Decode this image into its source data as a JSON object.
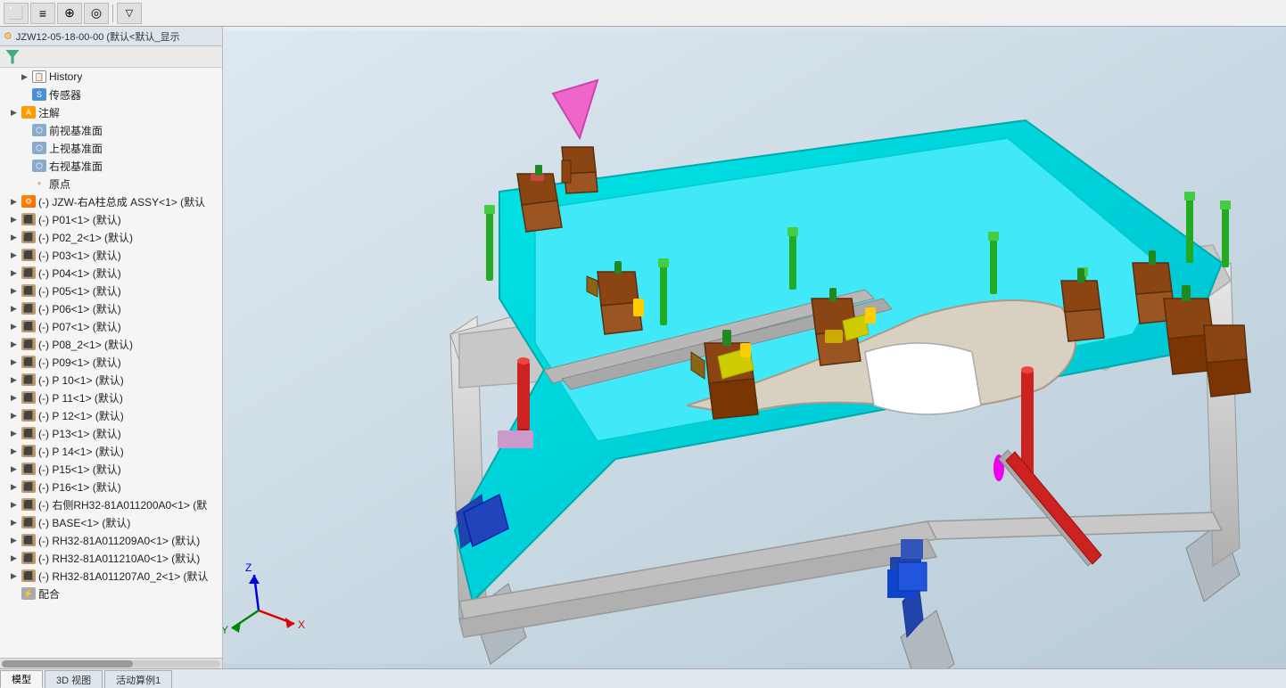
{
  "toolbar": {
    "buttons": [
      "⬜",
      "≡",
      "⊕",
      "◎",
      "⊗"
    ]
  },
  "sidebar": {
    "header_title": "JZW12-05-18-00-00  (默认<默认_显示",
    "tree_items": [
      {
        "id": "history",
        "label": "History",
        "icon": "history",
        "indent": 2,
        "expandable": true
      },
      {
        "id": "sensor",
        "label": "传感器",
        "icon": "sensor",
        "indent": 2,
        "expandable": false
      },
      {
        "id": "annotation",
        "label": "注解",
        "icon": "annotation",
        "indent": 1,
        "expandable": true
      },
      {
        "id": "front-plane",
        "label": "前视基准面",
        "icon": "plane",
        "indent": 2,
        "expandable": false
      },
      {
        "id": "top-plane",
        "label": "上视基准面",
        "icon": "plane",
        "indent": 2,
        "expandable": false
      },
      {
        "id": "right-plane",
        "label": "右视基准面",
        "icon": "plane",
        "indent": 2,
        "expandable": false
      },
      {
        "id": "origin",
        "label": "原点",
        "icon": "origin",
        "indent": 2,
        "expandable": false
      },
      {
        "id": "p1",
        "label": "(-) JZW-右A柱总成 ASSY<1> (默认",
        "icon": "assembly",
        "indent": 1,
        "expandable": true
      },
      {
        "id": "p2",
        "label": "(-) P01<1> (默认)",
        "icon": "part",
        "indent": 1,
        "expandable": true
      },
      {
        "id": "p3",
        "label": "(-) P02_2<1> (默认)",
        "icon": "part",
        "indent": 1,
        "expandable": true
      },
      {
        "id": "p4",
        "label": "(-) P03<1> (默认)",
        "icon": "part",
        "indent": 1,
        "expandable": true
      },
      {
        "id": "p5",
        "label": "(-) P04<1> (默认)",
        "icon": "part",
        "indent": 1,
        "expandable": true
      },
      {
        "id": "p6",
        "label": "(-) P05<1> (默认)",
        "icon": "part",
        "indent": 1,
        "expandable": true
      },
      {
        "id": "p7",
        "label": "(-) P06<1> (默认)",
        "icon": "part",
        "indent": 1,
        "expandable": true
      },
      {
        "id": "p8",
        "label": "(-) P07<1> (默认)",
        "icon": "part",
        "indent": 1,
        "expandable": true
      },
      {
        "id": "p9",
        "label": "(-) P08_2<1> (默认)",
        "icon": "part",
        "indent": 1,
        "expandable": true
      },
      {
        "id": "p10",
        "label": "(-) P09<1> (默认)",
        "icon": "part",
        "indent": 1,
        "expandable": true
      },
      {
        "id": "p11",
        "label": "(-) P 10<1> (默认)",
        "icon": "part",
        "indent": 1,
        "expandable": true
      },
      {
        "id": "p12",
        "label": "(-) P 11<1> (默认)",
        "icon": "part",
        "indent": 1,
        "expandable": true
      },
      {
        "id": "p13",
        "label": "(-) P 12<1> (默认)",
        "icon": "part",
        "indent": 1,
        "expandable": true
      },
      {
        "id": "p14",
        "label": "(-) P13<1> (默认)",
        "icon": "part",
        "indent": 1,
        "expandable": true
      },
      {
        "id": "p15",
        "label": "(-) P 14<1> (默认)",
        "icon": "part",
        "indent": 1,
        "expandable": true
      },
      {
        "id": "p16",
        "label": "(-) P15<1> (默认)",
        "icon": "part",
        "indent": 1,
        "expandable": true
      },
      {
        "id": "p17",
        "label": "(-) P16<1> (默认)",
        "icon": "part",
        "indent": 1,
        "expandable": true
      },
      {
        "id": "p18",
        "label": "(-) 右侧RH32-81A011200A0<1> (默",
        "icon": "part",
        "indent": 1,
        "expandable": true
      },
      {
        "id": "p19",
        "label": "(-) BASE<1> (默认)",
        "icon": "part",
        "indent": 1,
        "expandable": true
      },
      {
        "id": "p20",
        "label": "(-) RH32-81A011209A0<1> (默认)",
        "icon": "part",
        "indent": 1,
        "expandable": true
      },
      {
        "id": "p21",
        "label": "(-) RH32-81A011210A0<1> (默认)",
        "icon": "part",
        "indent": 1,
        "expandable": true
      },
      {
        "id": "p22",
        "label": "(-) RH32-81A011207A0_2<1> (默认",
        "icon": "part",
        "indent": 1,
        "expandable": true
      },
      {
        "id": "mating",
        "label": "配合",
        "icon": "mating",
        "indent": 1,
        "expandable": false
      }
    ]
  },
  "bottom_tabs": [
    {
      "id": "model",
      "label": "模型",
      "active": true
    },
    {
      "id": "3dview",
      "label": "3D 视图",
      "active": false
    },
    {
      "id": "motion",
      "label": "活动算例1",
      "active": false
    }
  ],
  "viewport": {
    "background_color": "#c8d8e8"
  },
  "axes": {
    "x_label": "X",
    "y_label": "Y",
    "z_label": "Z"
  }
}
